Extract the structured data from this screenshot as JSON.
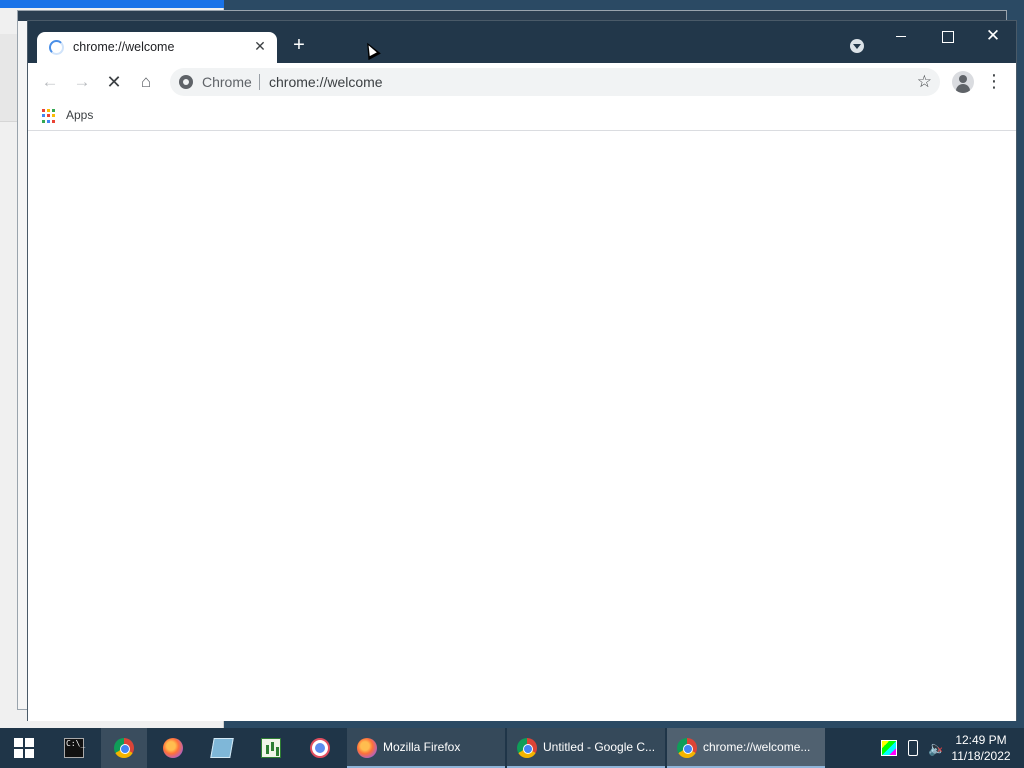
{
  "browser": {
    "tab": {
      "title": "chrome://welcome",
      "close_label": "✕"
    },
    "new_tab_label": "+",
    "window_close_label": "✕",
    "toolbar": {
      "back_label": "←",
      "forward_label": "→",
      "stop_label": "✕",
      "home_label": "⌂",
      "site_chip": "Chrome",
      "url": "chrome://welcome",
      "star_label": "☆",
      "menu_label": "⋮"
    },
    "bookmarks": {
      "apps_label": "Apps",
      "apps_colors": [
        "#ea4335",
        "#fbbc04",
        "#34a853",
        "#4285f4",
        "#ea4335",
        "#fbbc04",
        "#34a853",
        "#4285f4",
        "#ea4335"
      ]
    }
  },
  "taskbar": {
    "pinned": [
      {
        "name": "command-prompt",
        "icon": "terminal-icon",
        "glyph": "C:\\_"
      },
      {
        "name": "google-chrome",
        "icon": "chrome-icon"
      },
      {
        "name": "firefox",
        "icon": "firefox-icon"
      },
      {
        "name": "notepad",
        "icon": "notepad-icon"
      },
      {
        "name": "spreadsheet",
        "icon": "spreadsheet-icon"
      },
      {
        "name": "paint",
        "icon": "paint-icon"
      }
    ],
    "tasks": [
      {
        "label": "Mozilla Firefox",
        "icon": "firefox-icon"
      },
      {
        "label": "Untitled - Google C...",
        "icon": "chrome-icon"
      },
      {
        "label": "chrome://welcome...",
        "icon": "chrome-icon"
      }
    ],
    "tray": {
      "volume_glyph": "🔈",
      "time": "12:49 PM",
      "date": "11/18/2022"
    }
  }
}
